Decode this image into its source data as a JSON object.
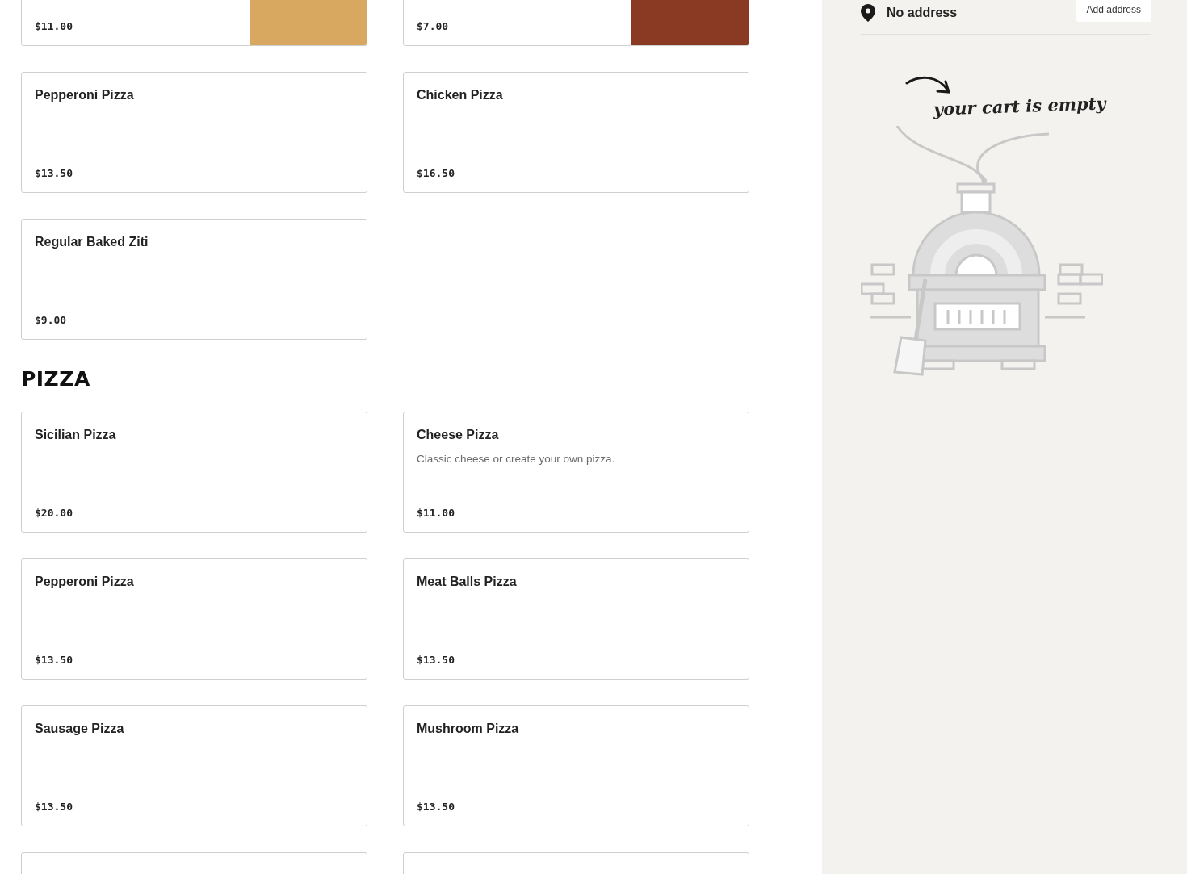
{
  "menu": {
    "sections": [
      {
        "items": [
          {
            "kind": "photo",
            "price": "$11.00"
          },
          {
            "kind": "photo",
            "price": "$7.00"
          },
          {
            "kind": "plain",
            "name": "Pepperoni Pizza",
            "price": "$13.50"
          },
          {
            "kind": "plain",
            "name": "Chicken Pizza",
            "price": "$16.50"
          },
          {
            "kind": "plain",
            "name": "Regular Baked Ziti",
            "price": "$9.00"
          }
        ]
      },
      {
        "title": "PIZZA",
        "items": [
          {
            "kind": "plain",
            "name": "Sicilian Pizza",
            "price": "$20.00"
          },
          {
            "kind": "plain",
            "name": "Cheese Pizza",
            "description": "Classic cheese or create your own pizza.",
            "price": "$11.00"
          },
          {
            "kind": "plain",
            "name": "Pepperoni Pizza",
            "price": "$13.50"
          },
          {
            "kind": "plain",
            "name": "Meat Balls Pizza",
            "price": "$13.50"
          },
          {
            "kind": "plain",
            "name": "Sausage Pizza",
            "price": "$13.50"
          },
          {
            "kind": "plain",
            "name": "Mushroom Pizza",
            "price": "$13.50"
          },
          {
            "kind": "plain"
          },
          {
            "kind": "plain"
          }
        ]
      }
    ]
  },
  "sidebar": {
    "address": "No address",
    "add_button": "Add address",
    "cart_message": "your cart is empty"
  }
}
